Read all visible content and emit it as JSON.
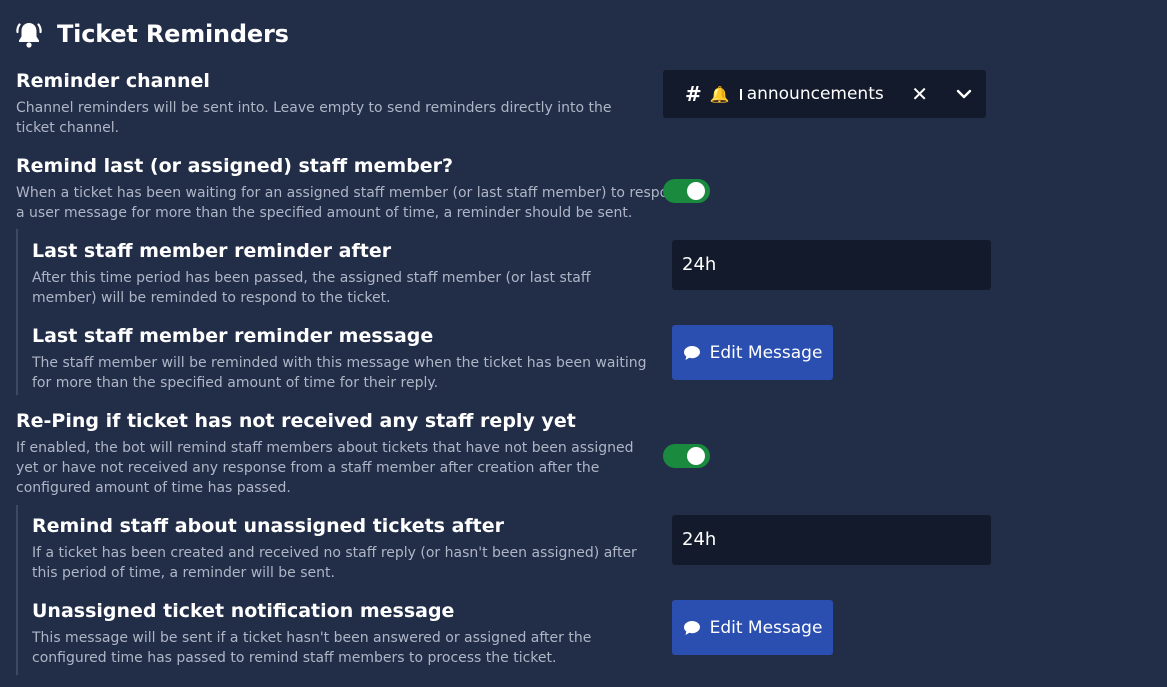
{
  "header": {
    "title": "Ticket Reminders",
    "icon": "bell-icon"
  },
  "reminder_channel": {
    "title": "Reminder channel",
    "description": "Channel reminders will be sent into. Leave empty to send reminders directly into the ticket channel.",
    "selected": {
      "hash": "#",
      "emoji": "🔔",
      "name": "announcements"
    },
    "clear": "✕"
  },
  "remind_last_staff": {
    "title": "Remind last (or assigned) staff member?",
    "description": "When a ticket has been waiting for an assigned staff member (or last staff member) to respond to a user message for more than the specified amount of time, a reminder should be sent.",
    "enabled": true
  },
  "last_staff_after": {
    "title": "Last staff member reminder after",
    "description": "After this time period has been passed, the assigned staff member (or last staff member) will be reminded to respond to the ticket.",
    "value": "24h"
  },
  "last_staff_message": {
    "title": "Last staff member reminder message",
    "description": "The staff member will be reminded with this message when the ticket has been waiting for more than the specified amount of time for their reply.",
    "button": "Edit Message"
  },
  "reping": {
    "title": "Re-Ping if ticket has not received any staff reply yet",
    "description": "If enabled, the bot will remind staff members about tickets that have not been assigned yet or have not received any response from a staff member after creation after the configured amount of time has passed.",
    "enabled": true
  },
  "unassigned_after": {
    "title": "Remind staff about unassigned tickets after",
    "description": "If a ticket has been created and received no staff reply (or hasn't been assigned) after this period of time, a reminder will be sent.",
    "value": "24h"
  },
  "unassigned_message": {
    "title": "Unassigned ticket notification message",
    "description": "This message will be sent if a ticket hasn't been answered or assigned after the configured time has passed to remind staff members to process the ticket.",
    "button": "Edit Message"
  },
  "colors": {
    "background": "#222d48",
    "toggle_on": "#1a8a3f",
    "button": "#2a4fb0",
    "input": "#131a2b"
  }
}
